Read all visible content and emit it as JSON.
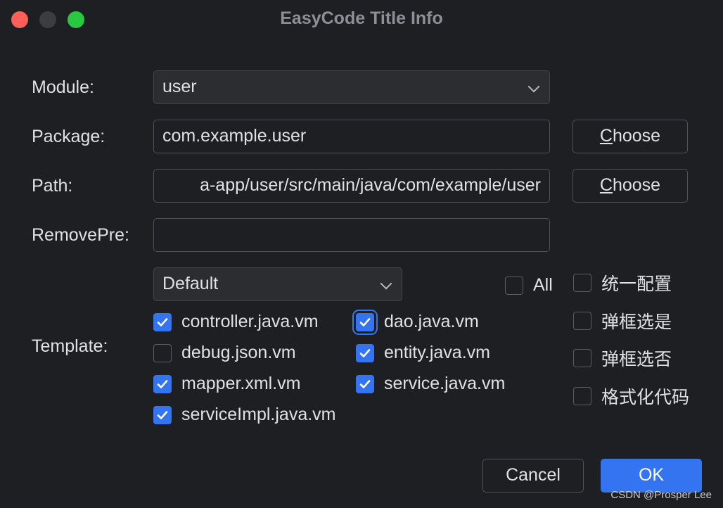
{
  "window": {
    "title": "EasyCode Title Info"
  },
  "form": {
    "module_label": "Module:",
    "module_value": "user",
    "package_label": "Package:",
    "package_value": "com.example.user",
    "path_label": "Path:",
    "path_value": "a-app/user/src/main/java/com/example/user",
    "removepre_label": "RemovePre:",
    "removepre_value": "",
    "template_label": "Template:",
    "template_group_value": "Default",
    "choose_mnemonic": "C",
    "choose_rest": "hoose"
  },
  "templates": [
    {
      "label": "controller.java.vm",
      "checked": true
    },
    {
      "label": "dao.java.vm",
      "checked": true
    },
    {
      "label": "debug.json.vm",
      "checked": false
    },
    {
      "label": "entity.java.vm",
      "checked": true
    },
    {
      "label": "mapper.xml.vm",
      "checked": true
    },
    {
      "label": "service.java.vm",
      "checked": true
    },
    {
      "label": "serviceImpl.java.vm",
      "checked": true
    }
  ],
  "all_label": "All",
  "options": [
    {
      "label": "统一配置",
      "checked": false
    },
    {
      "label": "弹框选是",
      "checked": false
    },
    {
      "label": "弹框选否",
      "checked": false
    },
    {
      "label": "格式化代码",
      "checked": false
    }
  ],
  "buttons": {
    "cancel": "Cancel",
    "ok": "OK"
  },
  "watermark": "CSDN @Prosper Lee",
  "colors": {
    "accent": "#3574f0",
    "background": "#1e1f22"
  }
}
